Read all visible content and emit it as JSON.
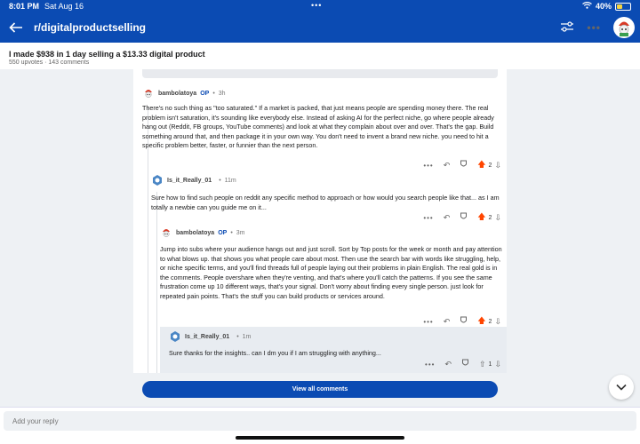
{
  "status": {
    "time": "8:01 PM",
    "date": "Sat Aug 16",
    "battery": "40%",
    "battery_level": 0.4
  },
  "appbar": {
    "subreddit": "r/digitalproductselling"
  },
  "post": {
    "title": "I made $938 in 1 day selling a $13.33 digital product",
    "meta": "550 upvotes · 143 comments"
  },
  "comments": [
    {
      "user": "bambolatoya",
      "op": "OP",
      "age": "3h",
      "text": "There's no such thing as \"too saturated.\" If a market is packed, that just means people are spending money there. The real problem isn't saturation, it's sounding like everybody else. Instead of asking AI for the perfect niche, go where people already hang out (Reddit, FB groups, YouTube comments) and look at what they complain about over and over. That's the gap. Build something around that, and then package it in your own way. You don't need to invent a brand new niche. you need to hit a specific problem better, faster, or funnier than the next person.",
      "votes": "2"
    },
    {
      "user": "Is_it_Really_01",
      "op": "",
      "age": "11m",
      "text": "Sure how to find such people on reddit any specific method to approach or how would you search people like that... as I am totally a newbie can you guide me on it...",
      "votes": "2"
    },
    {
      "user": "bambolatoya",
      "op": "OP",
      "age": "3m",
      "text": "Jump into subs where your audience hangs out and just scroll. Sort by Top posts for the week or month and pay attention to what blows up. that shows you what people care about most. Then use the search bar with words like struggling, help, or niche specific terms, and you'll find threads full of people laying out their problems in plain English. The real gold is in the comments. People overshare when they're venting, and that's where you'll catch the patterns. If you see the same frustration come up 10 different ways, that's your signal. Don't worry about finding every single person. just look for repeated pain points. That's the stuff you can build products or services around.",
      "votes": "2"
    },
    {
      "user": "Is_it_Really_01",
      "op": "",
      "age": "1m",
      "text": "Sure thanks for the insights.. can I dm you if I am struggling with anything...",
      "votes": "1"
    }
  ],
  "view_all": "View all comments",
  "reply": {
    "placeholder": "Add your reply"
  },
  "colors": {
    "brand": "#0b4bb3",
    "upvote": "#ff4500",
    "highlight": "#e8ecf1"
  }
}
